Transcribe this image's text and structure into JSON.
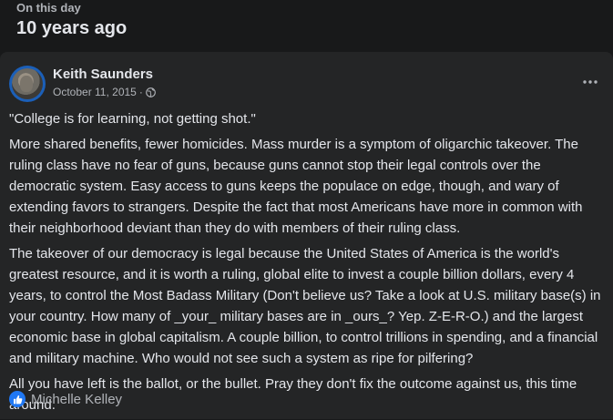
{
  "header": {
    "eyebrow": "On this day",
    "title": "10 years ago"
  },
  "post": {
    "author": "Keith Saunders",
    "date": "October 11, 2015",
    "separator": "·",
    "privacy_icon": "globe-icon",
    "menu_icon": "more-horizontal-icon",
    "paragraphs": [
      "\"College is for learning, not getting shot.\"",
      "More shared benefits, fewer homicides.  Mass murder is a symptom of oligarchic takeover.  The ruling class have no fear of guns, because guns cannot stop their legal controls over the democratic system.  Easy access to guns keeps the populace on edge, though, and wary of extending favors to strangers.  Despite the fact that most Americans have more in common with their neighborhood deviant than they do with members of their ruling class.",
      "The takeover of our democracy is legal because the United States of America is the world's greatest resource, and it is worth a ruling, global elite to invest a couple billion dollars, every 4 years, to control the Most Badass Military (Don't believe us? Take a look at U.S. military base(s) in your country. How many of _your_ military bases are in _ours_?  Yep.  Z-E-R-O.) and the largest economic base in global capitalism.  A couple billion, to control trillions in spending, and a financial and military machine.  Who would not see such a system as ripe for pilfering?",
      "All you have left is the ballot, or the bullet.  Pray they don't fix the outcome against us, this time around."
    ],
    "reactions": {
      "icon": "like-icon",
      "names": "Michelle Kelley"
    }
  },
  "colors": {
    "page_bg": "#18191a",
    "card_bg": "#242526",
    "primary_text": "#e4e6eb",
    "secondary_text": "#b0b3b8",
    "like_blue": "#2078f4"
  }
}
